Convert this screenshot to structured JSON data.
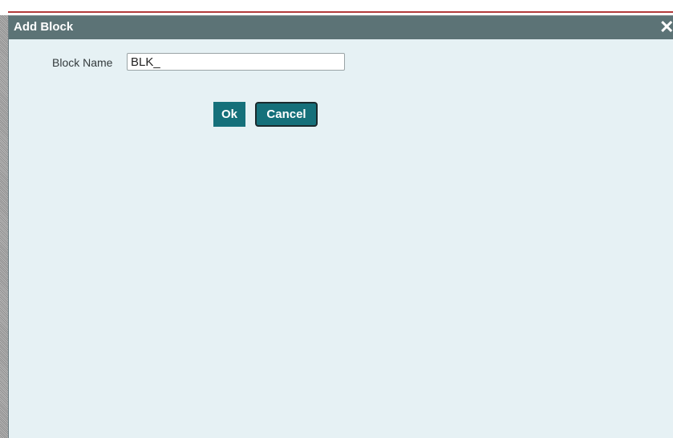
{
  "dialog": {
    "title": "Add Block",
    "close_glyph": "✕",
    "close_icon": "close-icon"
  },
  "form": {
    "block_name_label": "Block Name",
    "block_name_value": "BLK_"
  },
  "buttons": {
    "ok_label": "Ok",
    "cancel_label": "Cancel"
  },
  "colors": {
    "titlebar": "#5c7376",
    "dialog_bg": "#e6f1f4",
    "button_bg": "#15707a",
    "accent_line": "#b23b3b"
  }
}
